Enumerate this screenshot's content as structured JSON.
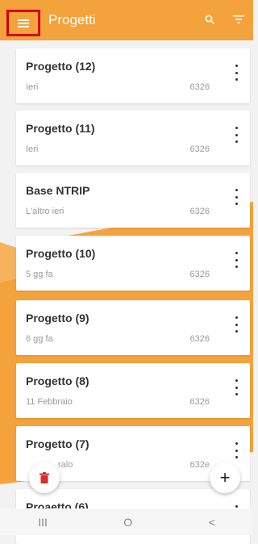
{
  "colors": {
    "accent": "#f4a23b",
    "highlight_border": "#d40000",
    "delete": "#d32f2f"
  },
  "topbar": {
    "title": "Progetti",
    "menu_icon": "hamburger-menu-icon",
    "search_icon": "search-icon",
    "filter_icon": "filter-icon"
  },
  "projects": [
    {
      "name": "Progetto (12)",
      "date": "Ieri",
      "code": "6326"
    },
    {
      "name": "Progetto (11)",
      "date": "Ieri",
      "code": "6326"
    },
    {
      "name": "Base NTRIP",
      "date": "L'altro ieri",
      "code": "6326"
    },
    {
      "name": "Progetto (10)",
      "date": "5 gg fa",
      "code": "6326"
    },
    {
      "name": "Progetto (9)",
      "date": "6 gg fa",
      "code": "6326"
    },
    {
      "name": "Progetto (8)",
      "date": "11 Febbraio",
      "code": "6326"
    },
    {
      "name": "Progetto (7)",
      "date": "ralo",
      "code": "632е"
    },
    {
      "name": "Proaetto (6)",
      "date": "",
      "code": ""
    }
  ],
  "fabs": {
    "delete_icon": "trash-icon",
    "add_label": "+"
  },
  "navbar": {
    "recent": "III",
    "home": "O",
    "back": "<"
  }
}
